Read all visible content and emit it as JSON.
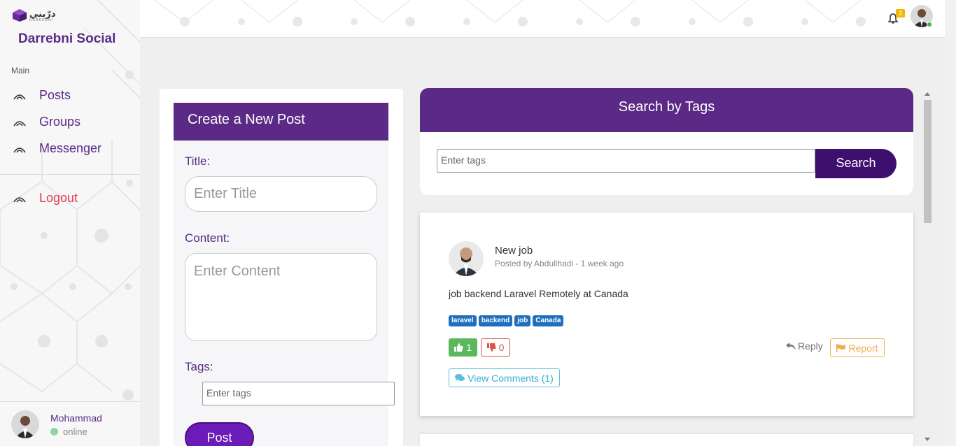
{
  "brand": {
    "logo_text": "درّبني",
    "logo_sub": "DARREBNI",
    "title": "Darrebni Social"
  },
  "sidebar": {
    "section": "Main",
    "items": [
      {
        "label": "Posts"
      },
      {
        "label": "Groups"
      },
      {
        "label": "Messenger"
      }
    ],
    "logout": "Logout",
    "user": {
      "name": "Mohammad",
      "status": "online"
    }
  },
  "topbar": {
    "notification_count": "3"
  },
  "create_post": {
    "heading": "Create a New Post",
    "title_label": "Title:",
    "title_placeholder": "Enter Title",
    "content_label": "Content:",
    "content_placeholder": "Enter Content",
    "tags_label": "Tags:",
    "tags_placeholder": "Enter tags",
    "submit": "Post"
  },
  "search": {
    "heading": "Search by Tags",
    "placeholder": "Enter tags",
    "button": "Search"
  },
  "post": {
    "title": "New job",
    "meta": "Posted by Abdullhadi - 1 week ago",
    "body": "job backend Laravel Remotely at Canada",
    "tags": [
      "laravel",
      "backend",
      "job",
      "Canada"
    ],
    "likes": "1",
    "dislikes": "0",
    "reply": "Reply",
    "report": "Report",
    "comments": "View Comments (1)"
  },
  "colors": {
    "accent": "#5b2a86",
    "button_dark": "#3f0f6e",
    "logout": "#e6374f",
    "tag": "#1f6fbf"
  }
}
